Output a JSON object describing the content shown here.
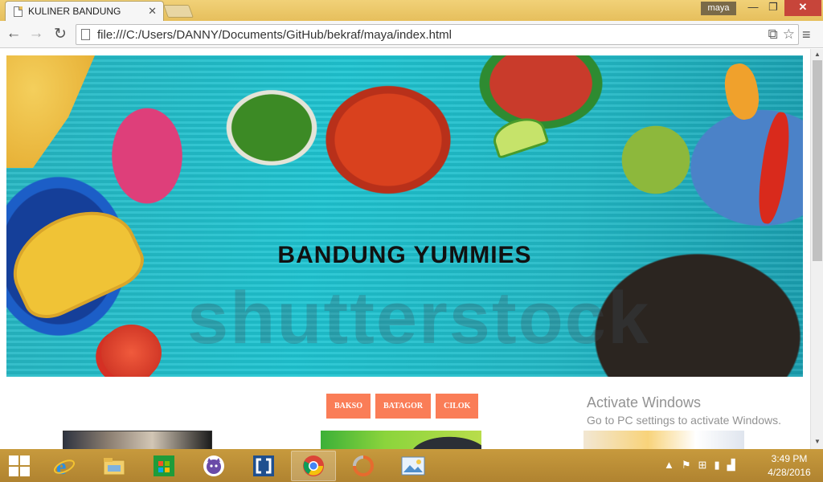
{
  "browser": {
    "tab_title": "KULINER BANDUNG",
    "tab_close": "✕",
    "profile_name": "maya",
    "url": "file:///C:/Users/DANNY/Documents/GitHub/bekraf/maya/index.html",
    "window_min": "—",
    "window_max": "❐",
    "window_close": "✕"
  },
  "page": {
    "hero_title": "BANDUNG YUMMIES",
    "hero_watermark": "shutterstock",
    "categories": [
      "BAKSO",
      "BATAGOR",
      "CILOK"
    ],
    "activate_windows": {
      "title": "Activate Windows",
      "subtitle": "Go to PC settings to activate Windows."
    }
  },
  "taskbar": {
    "apps": [
      "internet-explorer",
      "file-explorer",
      "store",
      "github",
      "brackets",
      "chrome",
      "app",
      "photos"
    ],
    "time": "3:49 PM",
    "date": "4/28/2016"
  },
  "colors": {
    "category_button": "#fa7d57",
    "titlebar": "#e6bf5c",
    "taskbar": "#b08330"
  }
}
